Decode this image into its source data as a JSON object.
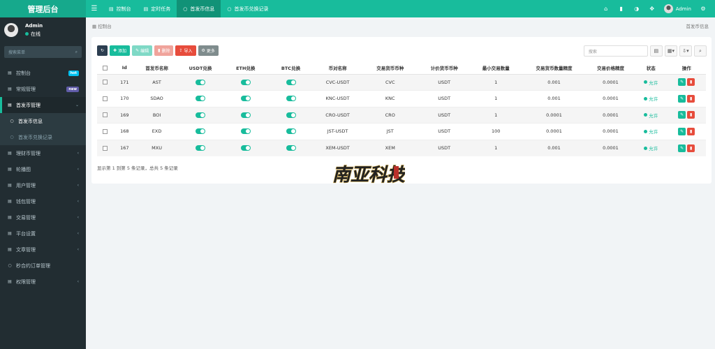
{
  "brand": "管理后台",
  "tabs": [
    {
      "label": "控制台",
      "icon": "dashboard-icon"
    },
    {
      "label": "定时任务",
      "icon": "tasks-icon"
    },
    {
      "label": "首发币信息",
      "icon": "circle-icon"
    },
    {
      "label": "首发币兑换记录",
      "icon": "circle-icon"
    }
  ],
  "header": {
    "user": "Admin"
  },
  "user": {
    "name": "Admin",
    "status": "在线"
  },
  "search": {
    "placeholder": "搜索菜单"
  },
  "nav": [
    {
      "label": "控制台",
      "badge": "hot",
      "badge_color": "#00c0ef",
      "icon": "dashboard-icon"
    },
    {
      "label": "常规管理",
      "badge": "new",
      "badge_color": "#605ca8",
      "icon": "cogs-icon"
    },
    {
      "label": "首发币管理",
      "icon": "list-icon",
      "open": true
    },
    {
      "label": "首发币信息",
      "sub": true,
      "active": true
    },
    {
      "label": "首发币兑换记录",
      "sub": true
    },
    {
      "label": "理财币管理",
      "icon": "list-icon",
      "chev": true
    },
    {
      "label": "轮播图",
      "icon": "list-icon",
      "chev": true
    },
    {
      "label": "用户管理",
      "icon": "list-icon",
      "chev": true
    },
    {
      "label": "钱包管理",
      "icon": "list-icon",
      "chev": true
    },
    {
      "label": "交易管理",
      "icon": "list-icon",
      "chev": true
    },
    {
      "label": "平台设置",
      "icon": "list-icon",
      "chev": true
    },
    {
      "label": "文章管理",
      "icon": "list-icon",
      "chev": true
    },
    {
      "label": "秒合约订单管理",
      "icon": "circle-icon"
    },
    {
      "label": "权限管理",
      "icon": "list-icon",
      "chev": true
    }
  ],
  "breadcrumb": {
    "left": "控制台",
    "right": "首发币信息"
  },
  "toolbar": {
    "add": "添加",
    "edit": "编辑",
    "delete": "删除",
    "import": "导入",
    "more": "更多"
  },
  "table_search": {
    "placeholder": "搜索"
  },
  "table": {
    "headers": [
      "Id",
      "首发币名称",
      "USDT兑换",
      "ETH兑换",
      "BTC兑换",
      "币对名称",
      "交易货币币种",
      "计价货币币种",
      "最小交易数量",
      "交易货币数量精度",
      "交易价格精度",
      "状态",
      "操作"
    ],
    "rows": [
      {
        "id": "171",
        "name": "AST",
        "pair": "CVC-USDT",
        "coin": "CVC",
        "quote": "USDT",
        "min": "1",
        "qty": "0.001",
        "price": "0.0001",
        "status": "允许"
      },
      {
        "id": "170",
        "name": "SDAO",
        "pair": "KNC-USDT",
        "coin": "KNC",
        "quote": "USDT",
        "min": "1",
        "qty": "0.001",
        "price": "0.0001",
        "status": "允许"
      },
      {
        "id": "169",
        "name": "BOI",
        "pair": "CRO-USDT",
        "coin": "CRO",
        "quote": "USDT",
        "min": "1",
        "qty": "0.0001",
        "price": "0.0001",
        "status": "允许"
      },
      {
        "id": "168",
        "name": "EXD",
        "pair": "JST-USDT",
        "coin": "JST",
        "quote": "USDT",
        "min": "100",
        "qty": "0.0001",
        "price": "0.0001",
        "status": "允许"
      },
      {
        "id": "167",
        "name": "MXU",
        "pair": "XEM-USDT",
        "coin": "XEM",
        "quote": "USDT",
        "min": "1",
        "qty": "0.001",
        "price": "0.0001",
        "status": "允许"
      }
    ]
  },
  "pager": "显示第 1 到第 5 条记录，总共 5 条记录",
  "watermark": {
    "text": "南亚科技",
    "label": "南亚科技"
  },
  "colors": {
    "primary": "#18bc9c",
    "sidebar": "#222d32",
    "danger": "#e74c3c",
    "add": "#18bc9c",
    "edit": "#1abc9c",
    "delete": "#e74c3c",
    "import": "#e74c3c",
    "more": "#95a5a6",
    "refresh": "#2c3e50"
  }
}
